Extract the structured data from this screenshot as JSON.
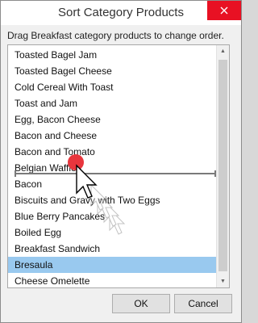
{
  "window": {
    "title": "Sort Category Products",
    "instructions": "Drag Breakfast category products to change order."
  },
  "list": {
    "items": [
      {
        "label": "Toasted Bagel Jam",
        "selected": false
      },
      {
        "label": "Toasted Bagel Cheese",
        "selected": false
      },
      {
        "label": "Cold Cereal With Toast",
        "selected": false
      },
      {
        "label": "Toast and Jam",
        "selected": false
      },
      {
        "label": "Egg, Bacon Cheese",
        "selected": false
      },
      {
        "label": "Bacon and Cheese",
        "selected": false
      },
      {
        "label": "Bacon and Tomato",
        "selected": false
      },
      {
        "label": "Belgian Waffles",
        "selected": false
      },
      {
        "label": "Bacon",
        "selected": false
      },
      {
        "label": "Biscuits and Gravy with Two Eggs",
        "selected": false
      },
      {
        "label": "Blue Berry Pancakes",
        "selected": false
      },
      {
        "label": "Boiled Egg",
        "selected": false
      },
      {
        "label": "Breakfast Sandwich",
        "selected": false
      },
      {
        "label": "Bresaula",
        "selected": true
      },
      {
        "label": "Cheese Omelette",
        "selected": false
      }
    ]
  },
  "buttons": {
    "ok_label": "OK",
    "cancel_label": "Cancel"
  },
  "colors": {
    "close_button": "#e81123",
    "selection": "#99c9ef",
    "drag_marker": "#e8363d"
  },
  "icons": {
    "close": "close-icon",
    "cursor": "drag-pointer-cursor",
    "marker": "drag-point-marker"
  }
}
